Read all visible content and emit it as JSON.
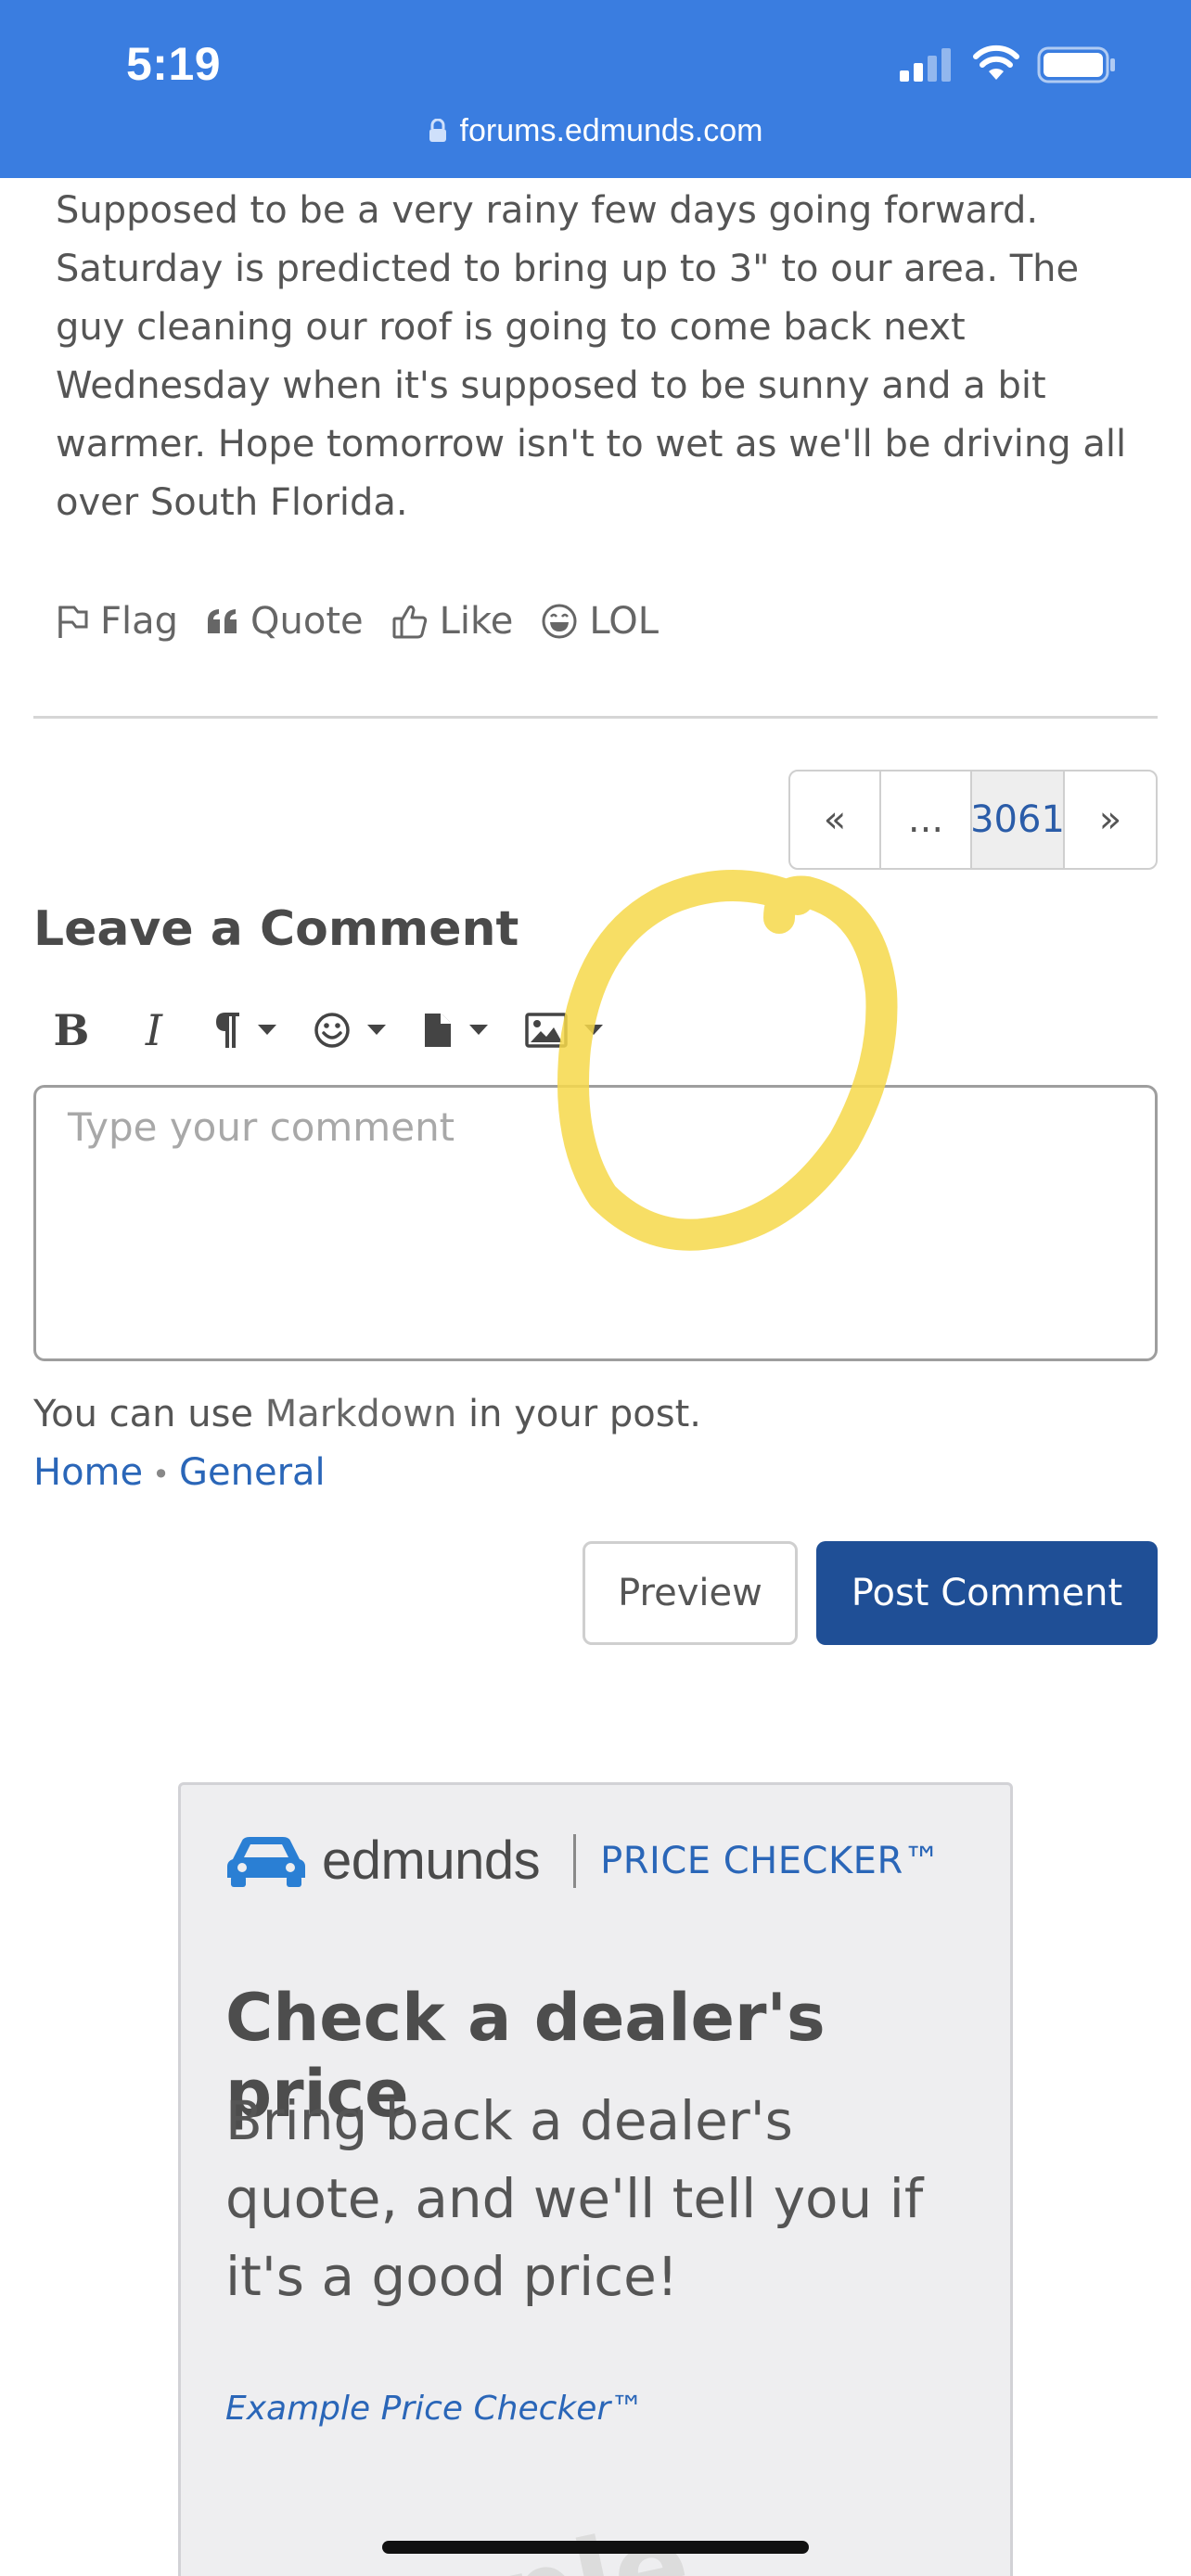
{
  "status_bar": {
    "time": "5:19",
    "url": "forums.edmunds.com",
    "bg_color": "#3a7de0",
    "icons": [
      "signal-icon",
      "wifi-icon",
      "battery-icon",
      "lock-icon"
    ]
  },
  "post": {
    "text": "Supposed to be a very rainy few days going forward. Saturday is predicted to bring up to 3\" to our area. The guy cleaning our roof is going to come back next Wednesday when it's supposed to be sunny and a bit warmer. Hope tomorrow isn't to wet as we'll be driving all over South Florida.",
    "reactions": [
      {
        "label": "Flag",
        "icon": "flag-icon"
      },
      {
        "label": "Quote",
        "icon": "quote-icon"
      },
      {
        "label": "Like",
        "icon": "thumbs-up-icon"
      },
      {
        "label": "LOL",
        "icon": "laughing-face-icon"
      }
    ]
  },
  "pager": {
    "prev": "«",
    "ellipsis": "...",
    "current": "3061",
    "next": "»"
  },
  "comment_form": {
    "title": "Leave a Comment",
    "toolbar": [
      {
        "name": "bold",
        "label": "B"
      },
      {
        "name": "italic",
        "label": "I"
      },
      {
        "name": "paragraph",
        "icon": "paragraph-icon"
      },
      {
        "name": "emoji",
        "icon": "smiley-icon"
      },
      {
        "name": "file",
        "icon": "file-icon"
      },
      {
        "name": "image",
        "icon": "image-icon"
      }
    ],
    "placeholder": "Type your comment",
    "markdown_prefix": "You can use ",
    "markdown_link": "Markdown",
    "markdown_suffix": " in your post.",
    "breadcrumbs": [
      "Home",
      "General"
    ],
    "preview_label": "Preview",
    "post_label": "Post Comment",
    "accent_color": "#1f4f96"
  },
  "annotation": {
    "color": "#f6d84a",
    "shape": "hand-drawn circle around image button"
  },
  "ad": {
    "brand": "edmunds",
    "product": "PRICE CHECKER™",
    "headline": "Check a dealer's price",
    "subtext": "Bring back a dealer's quote, and we'll tell you if it's a good price!",
    "example_link": "Example Price Checker™",
    "watermark": "ple"
  }
}
